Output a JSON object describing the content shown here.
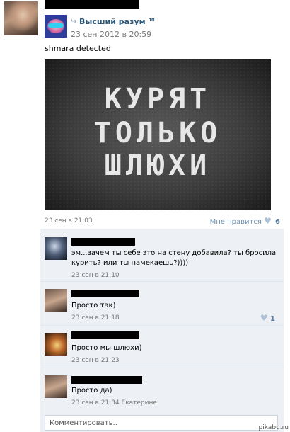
{
  "post": {
    "text": "shmara detected",
    "time": "23 сен в 21:03",
    "like_label": "Мне нравится",
    "like_count": "6"
  },
  "repost": {
    "arrow": "↪",
    "name": "Высший разум ™",
    "date": "23 сен 2012 в 20:59"
  },
  "image_text": {
    "line1": "КУРЯТ",
    "line2": "ТОЛЬКО",
    "line3": "ШЛЮХИ"
  },
  "comments": [
    {
      "text_line1": "эм...зачем ты себе это на стену добавила? ты бросила",
      "text_line2": "курить? или ты намекаешь?))))",
      "date": "23 сен в 21:10",
      "likes": ""
    },
    {
      "text_line1": "Просто так)",
      "text_line2": "",
      "date": "23 сен в 21:18",
      "likes": "1"
    },
    {
      "text_line1": "Просто мы шлюхи)",
      "text_line2": "",
      "date": "23 сен в 21:23",
      "likes": ""
    },
    {
      "text_line1": "Просто да)",
      "text_line2": "",
      "date": "23 сен в 21:34 Екатерине",
      "likes": ""
    }
  ],
  "composer": {
    "placeholder": "Комментировать.."
  },
  "watermark": "pikabu.ru",
  "colors": {
    "link": "#2b587a",
    "meta": "#777777",
    "comment_bg": "#edf1f5",
    "like": "#5b7fa6"
  }
}
